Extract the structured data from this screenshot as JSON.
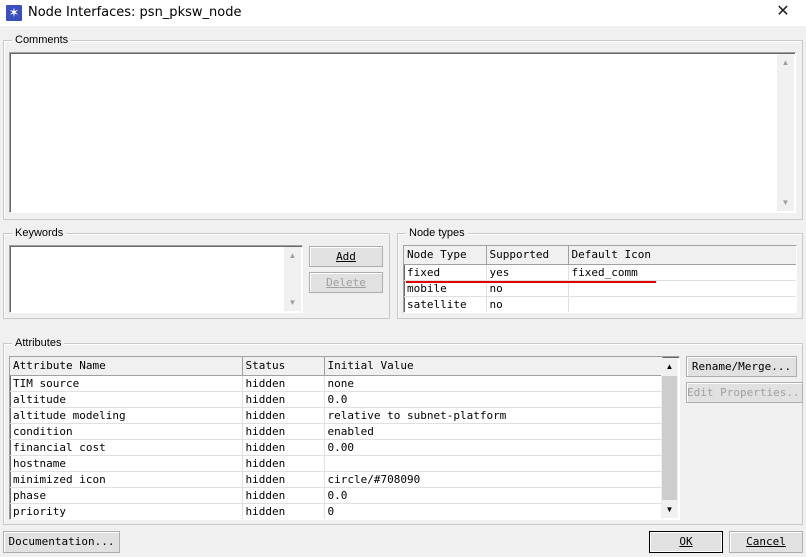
{
  "window": {
    "title": "Node Interfaces: psn_pksw_node",
    "app_icon": "opnet-star-icon",
    "close_glyph": "✕"
  },
  "comments": {
    "label": "Comments",
    "value": ""
  },
  "keywords": {
    "label": "Keywords",
    "value": "",
    "add_button": "Add",
    "delete_button": "Delete"
  },
  "node_types": {
    "label": "Node types",
    "columns": [
      "Node Type",
      "Supported",
      "Default Icon"
    ],
    "rows": [
      [
        "fixed",
        "yes",
        "fixed_comm"
      ],
      [
        "mobile",
        "no",
        ""
      ],
      [
        "satellite",
        "no",
        ""
      ]
    ],
    "highlight_color": "#e00000"
  },
  "attributes": {
    "label": "Attributes",
    "columns": [
      "Attribute Name",
      "Status",
      "Initial Value"
    ],
    "rows": [
      [
        "TIM source",
        "hidden",
        "none"
      ],
      [
        "altitude",
        "hidden",
        "0.0"
      ],
      [
        "altitude modeling",
        "hidden",
        "relative to subnet-platform"
      ],
      [
        "condition",
        "hidden",
        "enabled"
      ],
      [
        "financial cost",
        "hidden",
        "0.00"
      ],
      [
        "hostname",
        "hidden",
        ""
      ],
      [
        "minimized icon",
        "hidden",
        "circle/#708090"
      ],
      [
        "phase",
        "hidden",
        "0.0"
      ],
      [
        "priority",
        "hidden",
        "0"
      ]
    ],
    "rename_button": "Rename/Merge...",
    "edit_button": "Edit Properties..."
  },
  "footer": {
    "documentation_button": "Documentation...",
    "ok_button": "OK",
    "cancel_button": "Cancel"
  },
  "colors": {
    "dialog_bg": "#f0f0f0",
    "app_icon_bg": "#3a4fbf"
  }
}
